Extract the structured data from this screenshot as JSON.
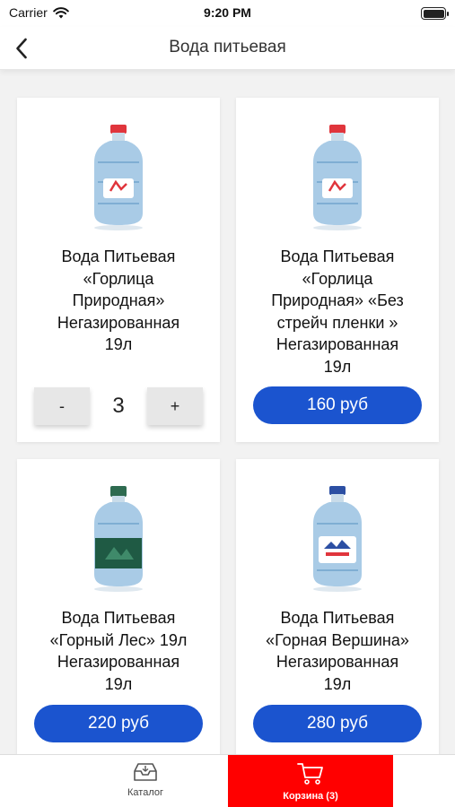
{
  "status": {
    "carrier": "Carrier",
    "time": "9:20 PM"
  },
  "nav": {
    "title": "Вода питьевая"
  },
  "products": [
    {
      "title_lines": [
        "Вода Питьевая",
        "«Горлица",
        "Природная»",
        "Негазированная",
        "19л"
      ],
      "quantity": "3",
      "minus": "-",
      "plus": "+"
    },
    {
      "title_lines": [
        "Вода Питьевая",
        "«Горлица",
        "Природная» «Без",
        "стрейч пленки »",
        "Негазированная",
        "19л"
      ],
      "price": "160 руб"
    },
    {
      "title_lines": [
        "Вода Питьевая",
        "«Горный Лес» 19л",
        "Негазированная",
        "19л"
      ],
      "price": "220 руб"
    },
    {
      "title_lines": [
        "Вода Питьевая",
        "«Горная Вершина»",
        "Негазированная",
        "19л"
      ],
      "price": "280 руб"
    }
  ],
  "tabbar": {
    "catalog": {
      "label": "Каталог",
      "icon": "inbox-icon"
    },
    "cart": {
      "label": "Корзина (3)",
      "icon": "cart-icon"
    }
  },
  "colors": {
    "accent_blue": "#1b54cf",
    "cart_tab_red": "#ff0000"
  }
}
